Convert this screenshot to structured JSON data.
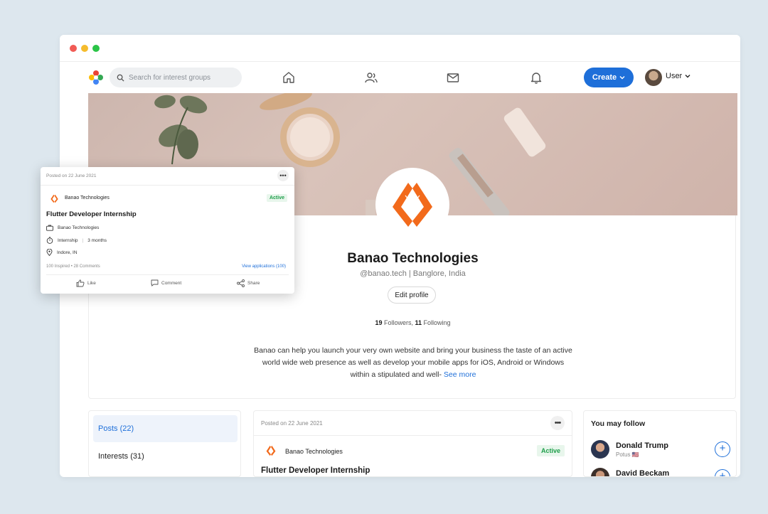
{
  "nav": {
    "search_placeholder": "Search for interest groups",
    "create_label": "Create",
    "user_label": "User"
  },
  "profile": {
    "name": "Banao Technologies",
    "handle_location": "@banao.tech | Banglore, India",
    "edit_label": "Edit profile",
    "followers_count": "19",
    "followers_label": "Followers,",
    "following_count": "11",
    "following_label": "Following",
    "bio": "Banao can help you launch your very own website and bring your business the taste of an active world wide web presence as well as develop your mobile apps for iOS, Android or Windows within a stipulated and well-",
    "see_more": "See more"
  },
  "left_nav": {
    "items": [
      {
        "label": "Posts (22)"
      },
      {
        "label": "Interests (31)"
      }
    ]
  },
  "post": {
    "date": "Posted on 22 June 2021",
    "company": "Banao Technologies",
    "status": "Active",
    "title": "Flutter Developer Internship"
  },
  "floating_post": {
    "date": "Posted on 22 June 2021",
    "company": "Banao Technologies",
    "status": "Active",
    "title": "Flutter Developer Internship",
    "org": "Banao Technologies",
    "type": "Internship",
    "duration": "3 months",
    "location": "Indore, IN",
    "stats": "100 Inspired  •  28 Comments",
    "view_applications": "View applications (100)",
    "like": "Like",
    "comment": "Comment",
    "share": "Share"
  },
  "may_follow": {
    "heading": "You may follow",
    "people": [
      {
        "name": "Donald Trump",
        "sub": "Potus 🇺🇸"
      },
      {
        "name": "David Beckam",
        "sub": ""
      }
    ]
  },
  "colors": {
    "accent": "#1e6fd9",
    "active_green": "#1e9e4a",
    "brand_orange": "#f26a1b",
    "background": "#dde7ee"
  }
}
